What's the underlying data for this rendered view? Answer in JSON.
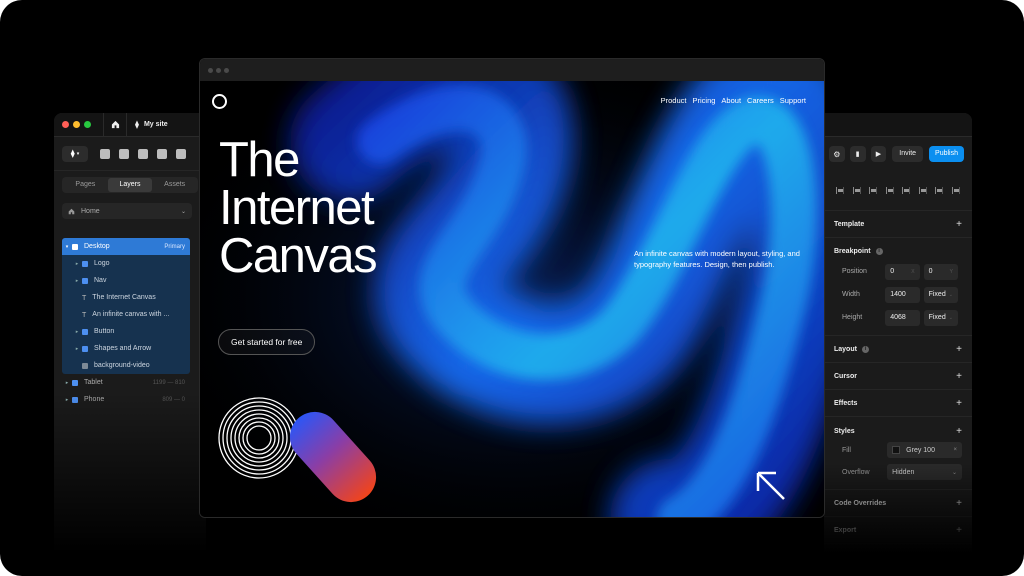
{
  "left_panel": {
    "site_name": "My site",
    "tabs": [
      "Pages",
      "Layers",
      "Assets"
    ],
    "active_tab": "Layers",
    "page_select": "Home",
    "layers": {
      "desktop": {
        "name": "Desktop",
        "tag": "Primary"
      },
      "children": [
        {
          "name": "Logo",
          "kind": "frame"
        },
        {
          "name": "Nav",
          "kind": "stack"
        },
        {
          "name": "The Internet Canvas",
          "kind": "text"
        },
        {
          "name": "An infinite canvas with ...",
          "kind": "text"
        },
        {
          "name": "Button",
          "kind": "frame"
        },
        {
          "name": "Shapes and Arrow",
          "kind": "stack"
        },
        {
          "name": "background-video",
          "kind": "video"
        }
      ],
      "tablet": {
        "name": "Tablet",
        "tag": "1199 — 810"
      },
      "phone": {
        "name": "Phone",
        "tag": "809 — 0"
      }
    }
  },
  "right_panel": {
    "invite_label": "Invite",
    "publish_label": "Publish",
    "sections": {
      "template": "Template",
      "breakpoint": "Breakpoint",
      "layout": "Layout",
      "cursor": "Cursor",
      "effects": "Effects",
      "styles": "Styles",
      "code_overrides": "Code Overrides",
      "export": "Export"
    },
    "breakpoint": {
      "position_label": "Position",
      "position_x": "0",
      "position_y": "0",
      "width_label": "Width",
      "width_value": "1400",
      "width_mode": "Fixed",
      "height_label": "Height",
      "height_value": "4068",
      "height_mode": "Fixed"
    },
    "styles": {
      "fill_label": "Fill",
      "fill_value": "Grey 100",
      "overflow_label": "Overflow",
      "overflow_value": "Hidden"
    }
  },
  "site": {
    "nav": [
      "Product",
      "Pricing",
      "About",
      "Careers",
      "Support"
    ],
    "title_lines": [
      "The",
      "Internet",
      "Canvas"
    ],
    "description": "An infinite canvas with modern layout, styling, and typography features. Design, then publish.",
    "cta_label": "Get started for free"
  },
  "colors": {
    "accent_blue": "#0b8ff0",
    "selected_layer": "#2e7ad6",
    "background": "#000000"
  }
}
